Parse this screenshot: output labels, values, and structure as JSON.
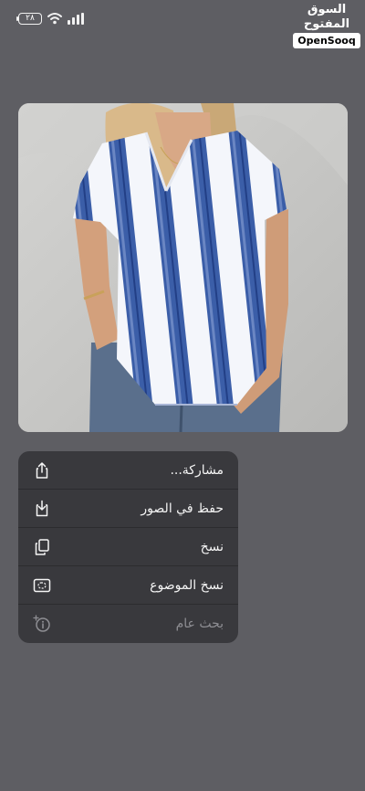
{
  "status_bar": {
    "battery_text": "٢٨"
  },
  "watermark": {
    "arabic": "السوق المفتوح",
    "latin": "OpenSooq"
  },
  "context_menu": {
    "items": [
      {
        "label": "مشاركة...",
        "icon": "share-icon",
        "enabled": true
      },
      {
        "label": "حفظ في الصور",
        "icon": "save-to-photos-icon",
        "enabled": true
      },
      {
        "label": "نسخ",
        "icon": "copy-icon",
        "enabled": true
      },
      {
        "label": "نسخ الموضوع",
        "icon": "copy-subject-icon",
        "enabled": true
      },
      {
        "label": "بحث عام",
        "icon": "visual-lookup-icon",
        "enabled": false
      }
    ]
  },
  "colors": {
    "background": "#5e5e63",
    "menu": "#39393d",
    "stripe_blue": "#3b5ea8"
  }
}
